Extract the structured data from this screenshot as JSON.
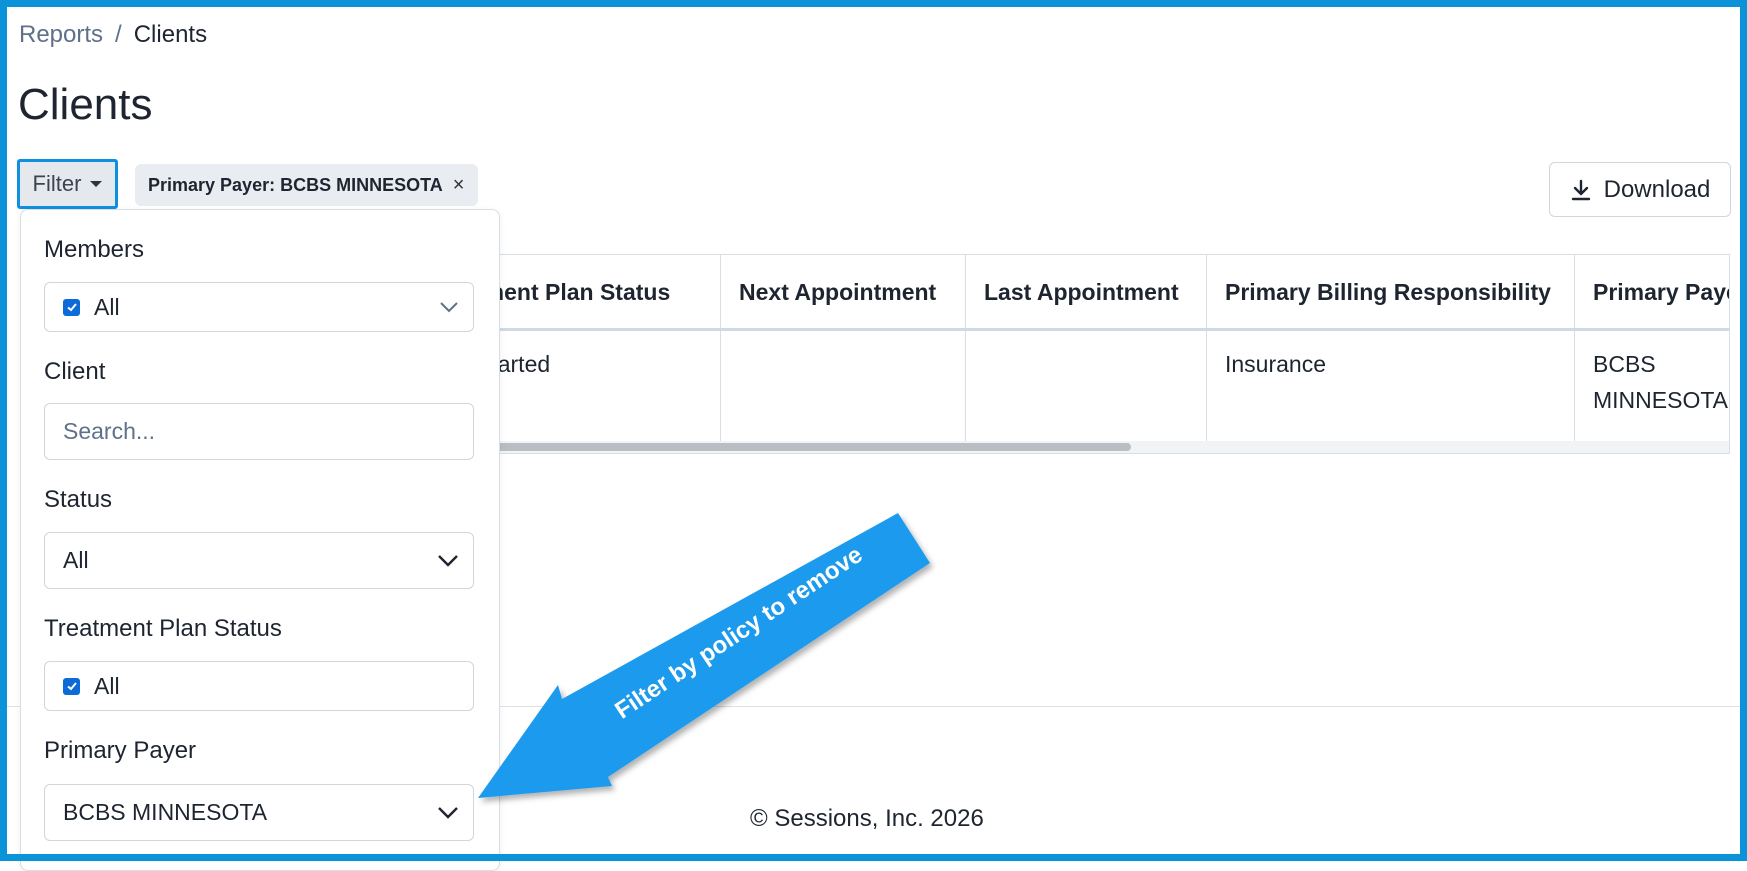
{
  "breadcrumb": {
    "parent": "Reports",
    "separator": "/",
    "current": "Clients"
  },
  "page": {
    "title": "Clients"
  },
  "toolbar": {
    "filter_label": "Filter",
    "active_filter_chip": "Primary Payer: BCBS MINNESOTA",
    "chip_remove": "×",
    "download_label": "Download"
  },
  "table": {
    "columns": [
      "tment Plan Status",
      "Next Appointment",
      "Last Appointment",
      "Primary Billing Responsibility",
      "Primary Paye"
    ],
    "rows": [
      [
        "Started",
        "",
        "",
        "Insurance",
        "BCBS MINNESOTA"
      ]
    ]
  },
  "filter_panel": {
    "members": {
      "label": "Members",
      "value": "All"
    },
    "client": {
      "label": "Client",
      "placeholder": "Search..."
    },
    "status": {
      "label": "Status",
      "value": "All"
    },
    "treatment_plan_status": {
      "label": "Treatment Plan Status",
      "value": "All"
    },
    "primary_payer": {
      "label": "Primary Payer",
      "value": "BCBS MINNESOTA"
    }
  },
  "annotation": {
    "text": "Filter by policy to remove",
    "color": "#1b9aee"
  },
  "footer": {
    "copyright": "© Sessions, Inc. 2026"
  },
  "colors": {
    "frame": "#0a93d9",
    "checkbox": "#0c6bd6",
    "focus": "#0f8fe0"
  }
}
